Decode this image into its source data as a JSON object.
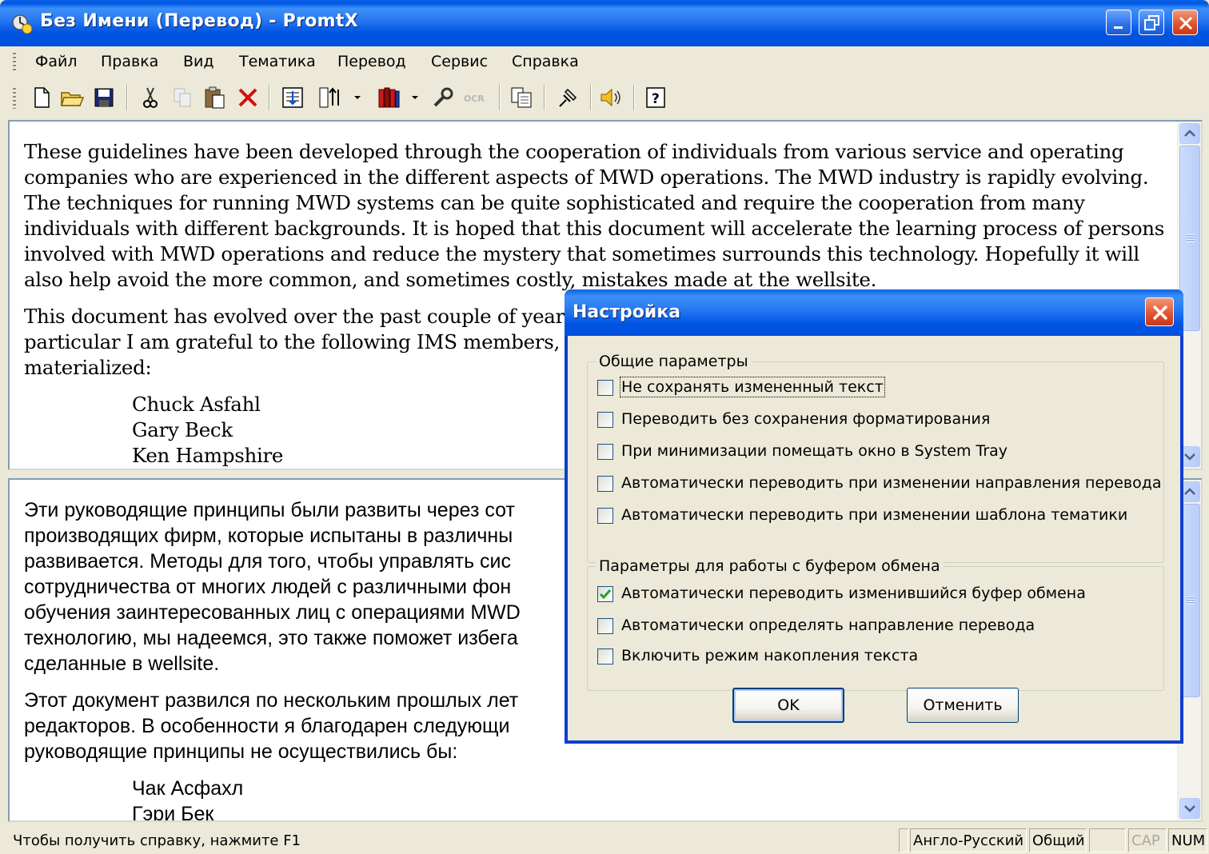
{
  "window": {
    "title": "Без Имени (Перевод) - PromtX"
  },
  "menu": {
    "items": [
      "Файл",
      "Правка",
      "Вид",
      "Тематика",
      "Перевод",
      "Сервис",
      "Справка"
    ]
  },
  "toolbar": {
    "buttons": [
      "new-document-icon",
      "open-folder-icon",
      "save-icon",
      "cut-icon",
      "copy-icon",
      "paste-icon",
      "delete-icon",
      "translate-icon",
      "direction-icon",
      "dictionaries-icon",
      "settings-wrench-icon",
      "ocr-icon",
      "clipboard-icon",
      "pin-icon",
      "speaker-icon",
      "help-icon"
    ]
  },
  "source_pane": {
    "paragraph1": "These guidelines have been developed through the cooperation of individuals from various service and operating companies who are experienced in the different aspects of MWD operations.  The MWD industry is rapidly evolving.  The techniques for running MWD systems can be quite sophisticated and require the cooperation from many individuals with different backgrounds.  It is hoped that this document will accelerate the learning process of persons involved with MWD operations and reduce the mystery that sometimes surrounds this technology.  Hopefully it will also help avoid the more common, and sometimes costly, mistakes made at the wellsite.",
    "paragraph2_line1": "This document has evolved over the past couple of years with",
    "paragraph2_line2": "particular I am grateful to the following IMS members, withou",
    "paragraph2_line3": "materialized:",
    "names": [
      "Chuck Asfahl",
      "Gary Beck",
      "Ken Hampshire"
    ]
  },
  "target_pane": {
    "lines": [
      "Эти руководящие принципы были развиты через сот",
      "производящих фирм, которые испытаны в различны",
      "развивается. Методы для того, чтобы управлять сис",
      "сотрудничества от многих людей с различными фон",
      "обучения заинтересованных лиц с операциями MWD",
      "технологию, мы надеемся, это также поможет избега",
      "сделанные в wellsite."
    ],
    "paragraph2": [
      "Этот документ развился по нескольким прошлых лет",
      "редакторов. В особенности я благодарен следующи",
      "руководящие принципы не осуществились бы:"
    ],
    "names": [
      "Чак Асфахл",
      "Гэри Бек"
    ]
  },
  "status": {
    "hint": "Чтобы получить справку, нажмите F1",
    "direction": "Англо-Русский",
    "topic": "Общий",
    "cap": "CAP",
    "num": "NUM"
  },
  "dialog": {
    "title": "Настройка",
    "group1": {
      "legend": "Общие параметры",
      "options": [
        {
          "label": "Не сохранять измененный текст",
          "checked": false
        },
        {
          "label": "Переводить без сохранения форматирования",
          "checked": false
        },
        {
          "label": "При минимизации помещать окно в System Tray",
          "checked": false
        },
        {
          "label": "Автоматически переводить при изменении направления перевода",
          "checked": false
        },
        {
          "label": "Автоматически переводить при изменении шаблона тематики",
          "checked": false
        }
      ]
    },
    "group2": {
      "legend": "Параметры для работы с буфером обмена",
      "options": [
        {
          "label": "Автоматически переводить изменившийся буфер обмена",
          "checked": true
        },
        {
          "label": "Автоматически определять направление перевода",
          "checked": false
        },
        {
          "label": "Включить режим накопления текста",
          "checked": false
        }
      ]
    },
    "ok_label": "OK",
    "cancel_label": "Отменить"
  }
}
